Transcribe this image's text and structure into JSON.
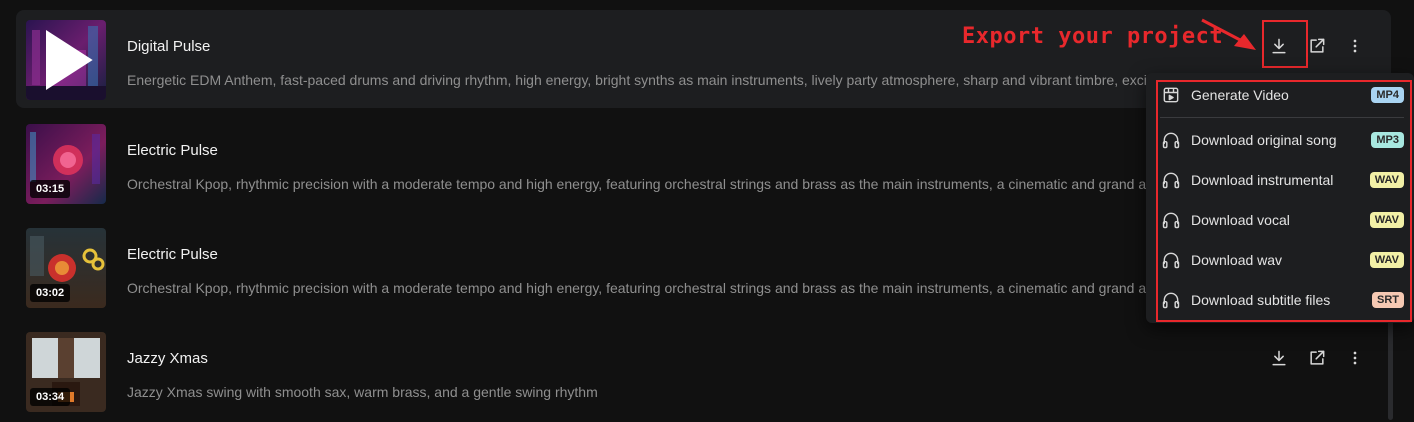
{
  "annotation": {
    "label": "Export your project"
  },
  "tracks": [
    {
      "title": "Digital Pulse",
      "description": "Energetic EDM Anthem, fast-paced drums and driving rhythm, high energy, bright synths as main instruments, lively party atmosphere, sharp and vibrant timbre, excitin",
      "duration": ""
    },
    {
      "title": "Electric Pulse",
      "description": "Orchestral Kpop, rhythmic precision with a moderate tempo and high energy, featuring orchestral strings and brass as the main instruments, a cinematic and grand atm",
      "duration": "03:15"
    },
    {
      "title": "Electric Pulse",
      "description": "Orchestral Kpop, rhythmic precision with a moderate tempo and high energy, featuring orchestral strings and brass as the main instruments, a cinematic and grand atm",
      "duration": "03:02"
    },
    {
      "title": "Jazzy Xmas",
      "description": "Jazzy Xmas swing with smooth sax, warm brass, and a gentle swing rhythm",
      "duration": "03:34"
    }
  ],
  "export_menu": {
    "items": [
      {
        "label": "Generate Video",
        "badge": "MP4",
        "badge_color": "#a9d4f2",
        "icon": "video-file-icon"
      },
      {
        "label": "Download original song",
        "badge": "MP3",
        "badge_color": "#a8e8e0",
        "icon": "headphones-icon"
      },
      {
        "label": "Download instrumental",
        "badge": "WAV",
        "badge_color": "#f2f0a6",
        "icon": "headphones-icon"
      },
      {
        "label": "Download vocal",
        "badge": "WAV",
        "badge_color": "#f2f0a6",
        "icon": "headphones-icon"
      },
      {
        "label": "Download wav",
        "badge": "WAV",
        "badge_color": "#f2f0a6",
        "icon": "headphones-icon"
      },
      {
        "label": "Download subtitle files",
        "badge": "SRT",
        "badge_color": "#f6c9b3",
        "icon": "headphones-icon"
      }
    ]
  },
  "colors": {
    "highlight": "#e8282c",
    "background": "#111111",
    "active_row": "#1d1e20"
  }
}
